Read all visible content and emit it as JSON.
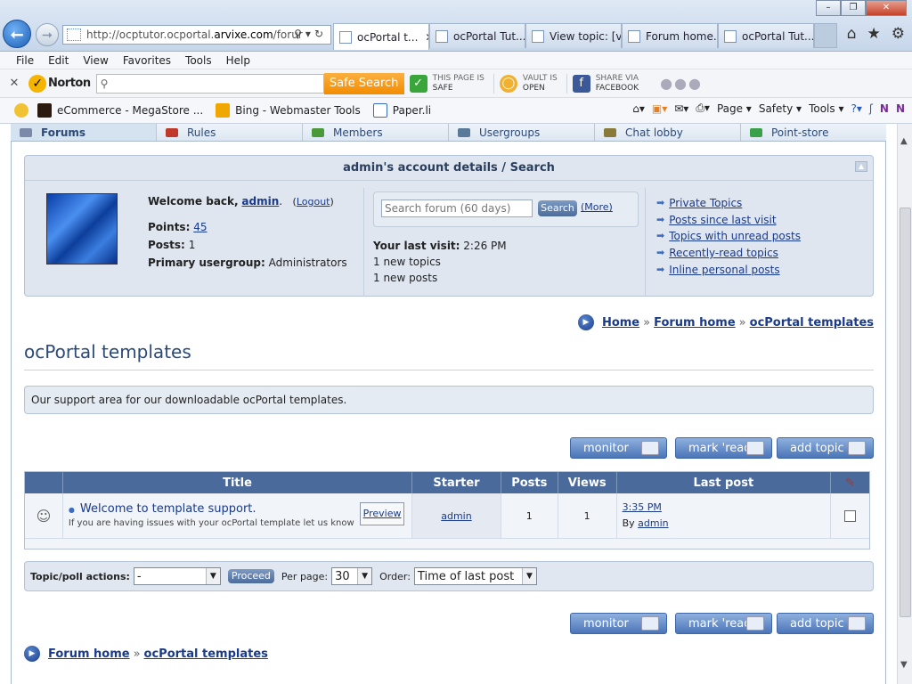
{
  "browser": {
    "address_prefix": "http://ocptutor.ocportal.",
    "address_domain": "arvixe.com",
    "address_suffix": "/forur",
    "tabs": [
      {
        "label": "ocPortal t..."
      },
      {
        "label": "ocPortal Tut..."
      },
      {
        "label": "View topic: [v..."
      },
      {
        "label": "Forum home..."
      },
      {
        "label": "ocPortal Tut..."
      }
    ],
    "tab_close": "✕",
    "window_controls": [
      "–",
      "❐",
      "✕"
    ]
  },
  "menu": [
    "File",
    "Edit",
    "View",
    "Favorites",
    "Tools",
    "Help"
  ],
  "norton": {
    "close": "✕",
    "logo": "Norton",
    "search_button": "Safe Search",
    "page_safe_line1": "THIS PAGE IS",
    "page_safe_line2": "SAFE",
    "vault_line1": "VAULT IS",
    "vault_line2": "OPEN",
    "share_line1": "SHARE VIA",
    "share_line2": "FACEBOOK",
    "more": "●●●"
  },
  "favorites": {
    "items": [
      "eCommerce - MegaStore ...",
      "Bing - Webmaster Tools",
      "Paper.li"
    ],
    "commands": [
      "Page ▾",
      "Safety ▾",
      "Tools ▾"
    ]
  },
  "nav_tabs": [
    "Forums",
    "Rules",
    "Members",
    "Usergroups",
    "Chat lobby",
    "Point-store"
  ],
  "account": {
    "title": "admin's account details / Search",
    "welcome": "Welcome back,",
    "username": "admin",
    "logout": "Logout",
    "points_label": "Points:",
    "points_value": "45",
    "posts_label": "Posts:",
    "posts_value": "1",
    "group_label": "Primary usergroup:",
    "group_value": "Administrators",
    "search_placeholder": "Search forum (60 days)",
    "search_button": "Search",
    "more": "(More)",
    "last_visit_label": "Your last visit:",
    "last_visit_value": "2:26 PM",
    "new_topics": "1 new topics",
    "new_posts": "1 new posts",
    "links": [
      "Private Topics",
      "Posts since last visit",
      "Topics with unread posts",
      "Recently-read topics",
      "Inline personal posts"
    ]
  },
  "breadcrumb": {
    "home": "Home",
    "forum_home": "Forum home",
    "current": "ocPortal templates",
    "sep": "»"
  },
  "page": {
    "title": "ocPortal templates",
    "description": "Our support area for our downloadable ocPortal templates."
  },
  "buttons": {
    "monitor": "monitor",
    "mark_read": "mark 'read'",
    "add_topic": "add topic"
  },
  "table": {
    "headers": [
      "Title",
      "Starter",
      "Posts",
      "Views",
      "Last post"
    ],
    "rows": [
      {
        "title": "Welcome to template support.",
        "subtitle": "If you are having issues with your ocPortal template let us know",
        "preview": "Preview",
        "starter": "admin",
        "posts": "1",
        "views": "1",
        "last_time": "3:35 PM",
        "last_by_label": "By",
        "last_by": "admin"
      }
    ]
  },
  "actions": {
    "topic_label": "Topic/poll actions:",
    "topic_value": "-",
    "proceed": "Proceed",
    "per_page_label": "Per page:",
    "per_page_value": "30",
    "order_label": "Order:",
    "order_value": "Time of last post"
  },
  "bottom_breadcrumb": {
    "forum_home": "Forum home",
    "current": "ocPortal templates"
  }
}
